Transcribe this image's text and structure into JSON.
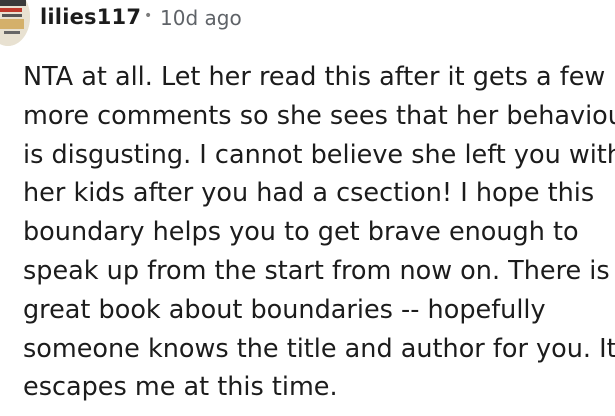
{
  "comment": {
    "author": "lilies117",
    "separator": "•",
    "timestamp": "10d ago",
    "body": "NTA at all. Let her read this after it gets a few\nmore comments so she sees that her behaviour\nis disgusting. I cannot believe she left you with\nher kids after you had a csection! I hope this\nboundary helps you to get brave enough to\nspeak up from the start from now on. There is a\ngreat book about boundaries -- hopefully\nsomeone knows the title and author for you. It\nescapes me at this time."
  },
  "icons": {
    "avatar": "user-avatar-icon"
  }
}
